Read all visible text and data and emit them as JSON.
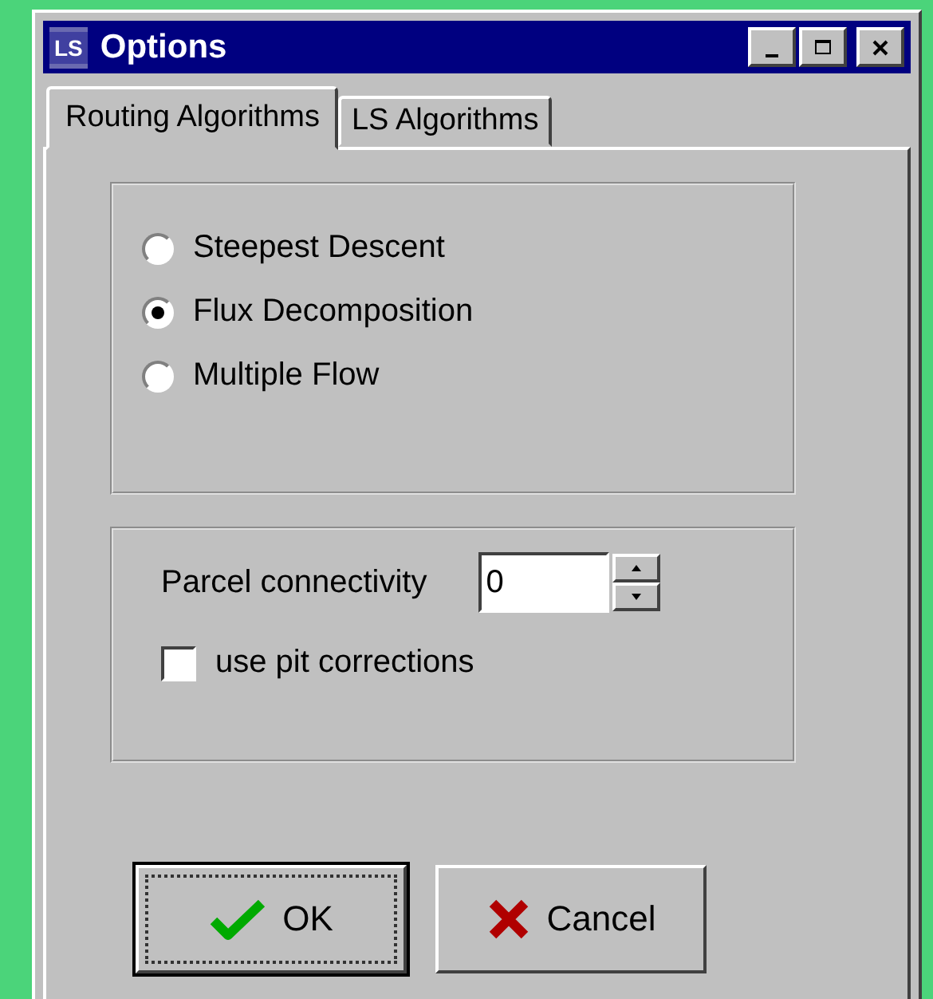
{
  "window": {
    "icon_text": "LS",
    "title": "Options"
  },
  "tabs": [
    {
      "label": "Routing Algorithms",
      "selected": true
    },
    {
      "label": "LS Algorithms",
      "selected": false
    }
  ],
  "routing": [
    {
      "label": "Steepest Descent",
      "selected": false
    },
    {
      "label": "Flux Decomposition",
      "selected": true
    },
    {
      "label": "Multiple Flow",
      "selected": false
    }
  ],
  "parcel_connectivity": {
    "label": "Parcel connectivity",
    "value": "0"
  },
  "pit_corrections": {
    "label": "use pit corrections",
    "checked": false
  },
  "buttons": [
    {
      "kind": "ok",
      "label": "OK",
      "default": true
    },
    {
      "kind": "cancel",
      "label": "Cancel",
      "default": false
    }
  ]
}
